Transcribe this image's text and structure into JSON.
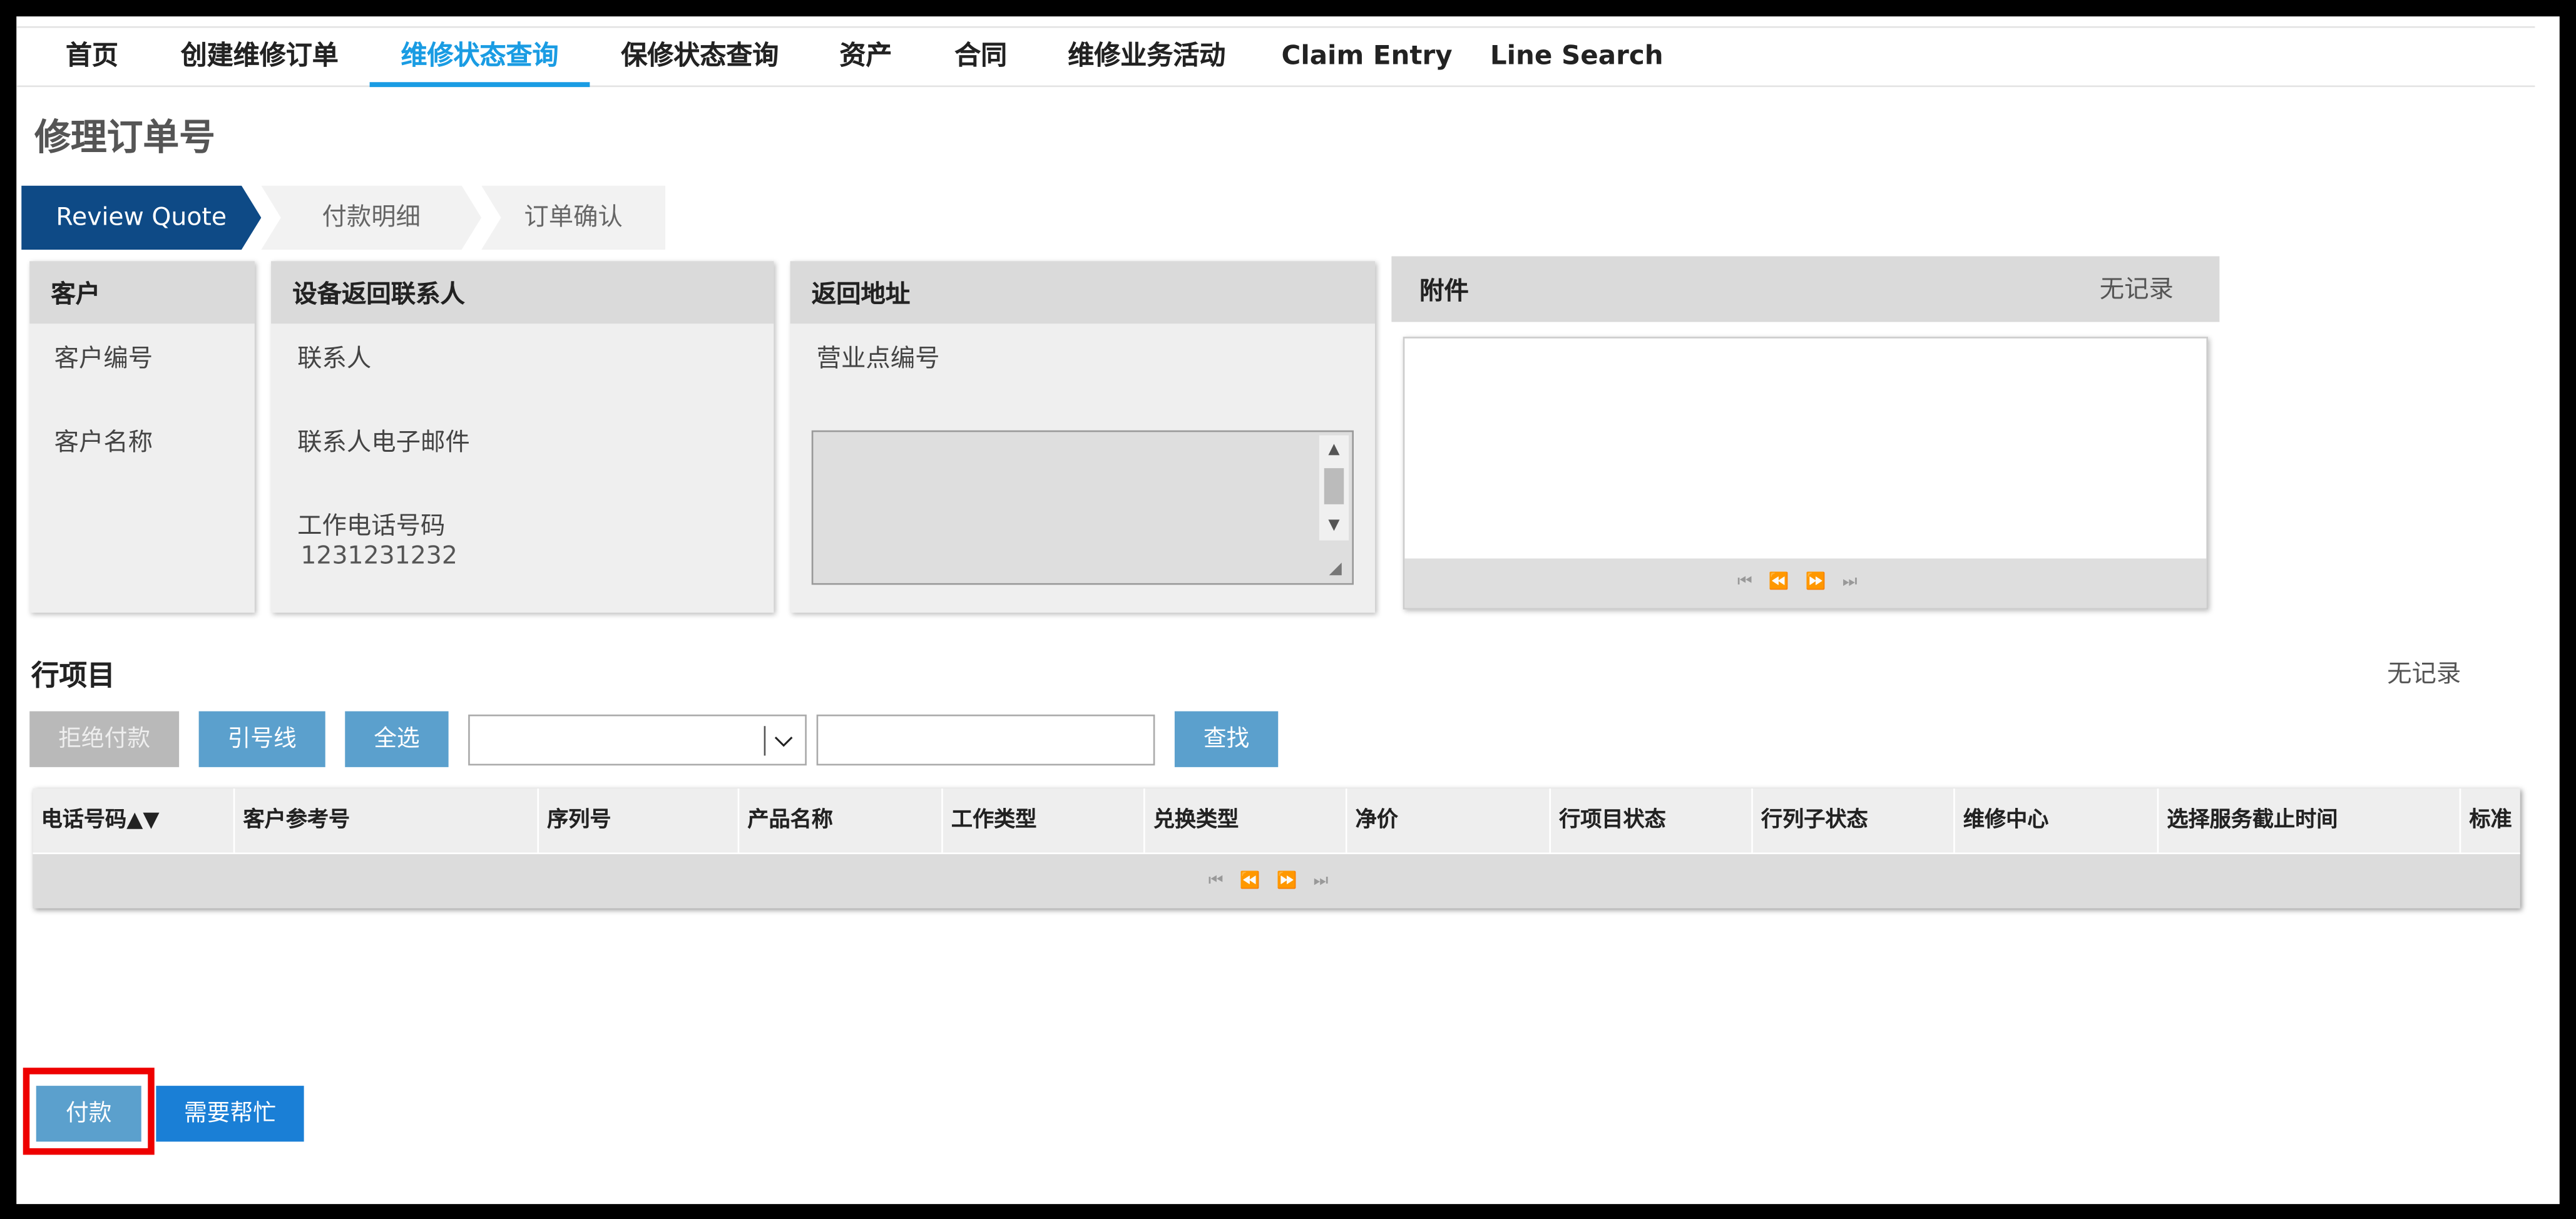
{
  "nav": {
    "items": [
      {
        "label": "首页",
        "active": false
      },
      {
        "label": "创建维修订单",
        "active": false
      },
      {
        "label": "维修状态查询",
        "active": true
      },
      {
        "label": "保修状态查询",
        "active": false
      },
      {
        "label": "资产",
        "active": false
      },
      {
        "label": "合同",
        "active": false
      },
      {
        "label": "维修业务活动",
        "active": false
      },
      {
        "label": "Claim Entry",
        "active": false
      },
      {
        "label": "Line Search",
        "active": false
      }
    ]
  },
  "page": {
    "title": "修理订单号"
  },
  "steps": [
    {
      "label": "Review Quote",
      "active": true
    },
    {
      "label": "付款明细",
      "active": false
    },
    {
      "label": "订单确认",
      "active": false
    }
  ],
  "customer_panel": {
    "title": "客户",
    "fields": [
      "客户编号",
      "客户名称"
    ]
  },
  "contact_panel": {
    "title": "设备返回联系人",
    "contact_label": "联系人",
    "email_label": "联系人电子邮件",
    "phone_label": "工作电话号码",
    "phone_value": "1231231232"
  },
  "address_panel": {
    "title": "返回地址",
    "outlet_label": "营业点编号"
  },
  "attachments": {
    "title": "附件",
    "empty_text": "无记录",
    "pager": "⏮⏪⏩⏭"
  },
  "line_items": {
    "title": "行项目",
    "empty_text": "无记录",
    "buttons": {
      "reject_payment": "拒绝付款",
      "reference_line": "引号线",
      "select_all": "全选",
      "search": "查找"
    },
    "search_value": "",
    "columns": [
      "电话号码▲▼",
      "客户参考号",
      "序列号",
      "产品名称",
      "工作类型",
      "兑换类型",
      "净价",
      "行项目状态",
      "行列子状态",
      "维修中心",
      "选择服务截止时间",
      "标准"
    ],
    "pager": "⏮⏪⏩⏭"
  },
  "footer": {
    "pay_button": "付款",
    "help_button": "需要帮忙"
  },
  "colors": {
    "accent": "#1a9ce3",
    "step_active": "#0e4a86",
    "button": "#5ba0cd",
    "highlight": "#ee0000"
  }
}
